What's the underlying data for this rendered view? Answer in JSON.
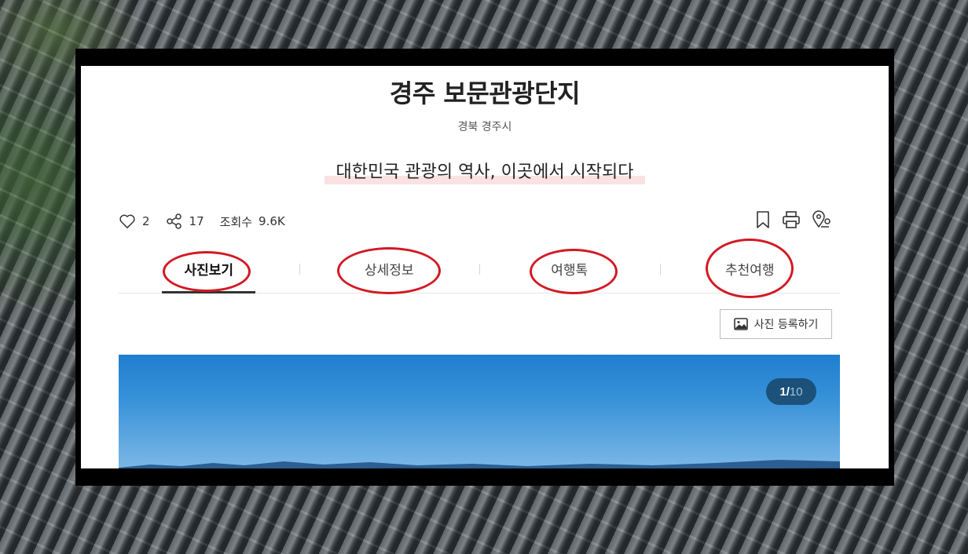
{
  "place": {
    "title": "경주 보문관광단지",
    "region": "경북 경주시",
    "tagline": "대한민국 관광의 역사, 이곳에서 시작되다"
  },
  "stats": {
    "likes": "2",
    "shares": "17",
    "views_label": "조회수",
    "views": "9.6K"
  },
  "actions": {
    "bookmark_icon": "bookmark-icon",
    "print_icon": "print-icon",
    "map_icon": "map-pin-icon"
  },
  "tabs": [
    {
      "label": "사진보기",
      "active": true
    },
    {
      "label": "상세정보",
      "active": false
    },
    {
      "label": "여행톡",
      "active": false
    },
    {
      "label": "추천여행",
      "active": false
    }
  ],
  "photo_button": {
    "label": "사진 등록하기",
    "icon": "image-icon"
  },
  "gallery": {
    "current": "1",
    "separator": "/",
    "total": "10"
  },
  "colors": {
    "annotation_circle": "#d21a24",
    "tab_underline": "#333333",
    "sky": "#1f7ed0"
  }
}
